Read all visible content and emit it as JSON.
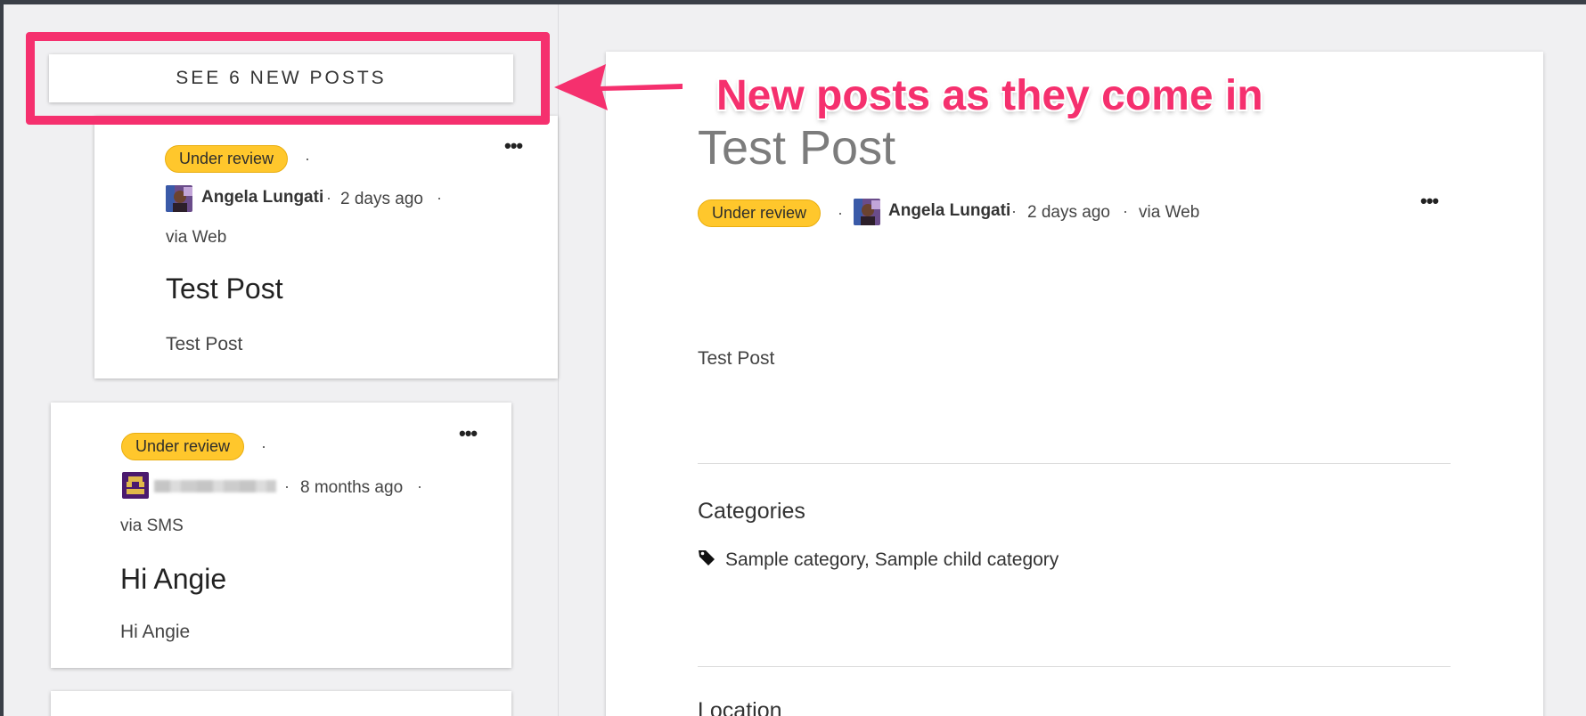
{
  "list": {
    "see_new_label": "SEE 6 NEW POSTS",
    "posts": [
      {
        "status": "Under review",
        "author": "Angela Lungati",
        "time": "2 days ago",
        "source": "via Web",
        "title": "Test Post",
        "body": "Test Post"
      },
      {
        "status": "Under review",
        "time": "8 months ago",
        "source": "via SMS",
        "title": "Hi Angie",
        "body": "Hi Angie"
      }
    ]
  },
  "detail": {
    "title": "Test Post",
    "status": "Under review",
    "author": "Angela Lungati",
    "time": "2 days ago",
    "source": "via Web",
    "body": "Test Post",
    "categories_heading": "Categories",
    "categories": "Sample category, Sample child category",
    "location_heading": "Location"
  },
  "annotation": {
    "text": "New posts as they come in"
  },
  "icons": {
    "more": "more-icon",
    "tag": "tag-icon",
    "arrow": "arrow-left-icon"
  },
  "colors": {
    "accent": "#f5306e",
    "badge": "#ffc72c",
    "frame": "#3a3f47"
  }
}
